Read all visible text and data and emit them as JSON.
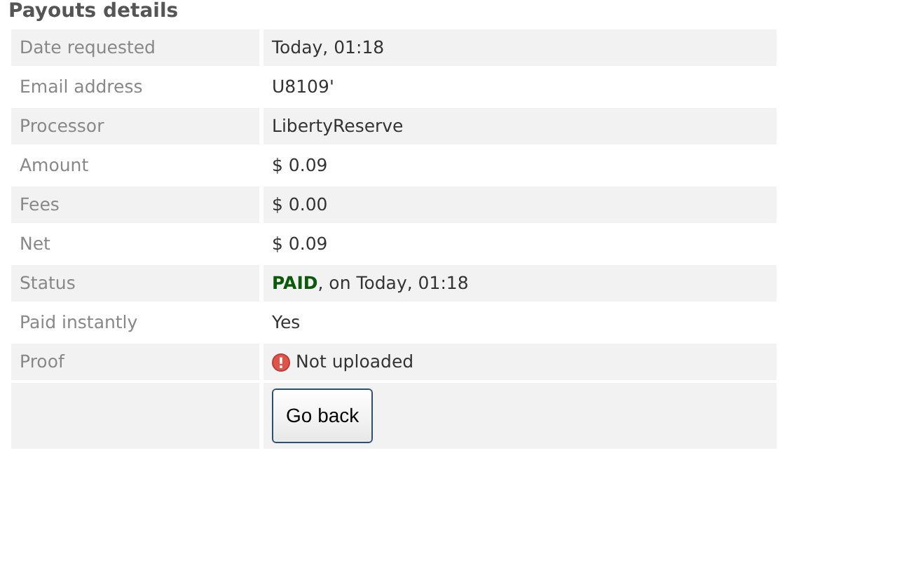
{
  "title": "Payouts details",
  "rows": [
    {
      "label": "Date requested",
      "value": "Today, 01:18",
      "kind": "text"
    },
    {
      "label": "Email address",
      "value": "U8109'",
      "kind": "text"
    },
    {
      "label": "Processor",
      "value": "LibertyReserve",
      "kind": "text"
    },
    {
      "label": "Amount",
      "value": "$ 0.09",
      "kind": "text"
    },
    {
      "label": "Fees",
      "value": "$ 0.00",
      "kind": "text"
    },
    {
      "label": "Net",
      "value": "$ 0.09",
      "kind": "text"
    },
    {
      "label": "Status",
      "value": "**PAID**, on Today, 01:18",
      "kind": "text"
    },
    {
      "label": "Paid instantly",
      "value": "Yes",
      "kind": "text"
    },
    {
      "label": "Proof",
      "value": "Not uploaded",
      "kind": "error"
    }
  ],
  "button": "Go back"
}
